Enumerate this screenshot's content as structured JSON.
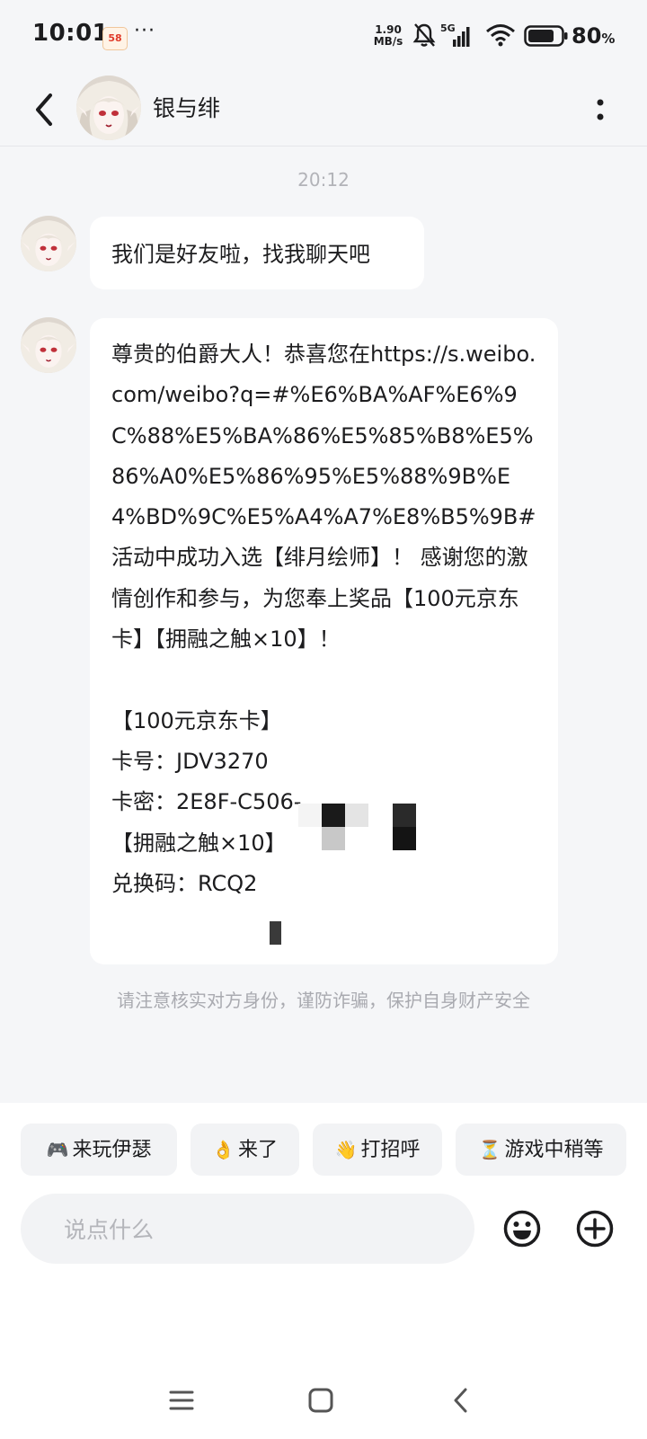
{
  "status_bar": {
    "time": "10:01",
    "app_badge": "58",
    "more": "···",
    "net_speed_value": "1.90",
    "net_speed_unit": "MB/s",
    "network": "5G",
    "battery_value": "80",
    "battery_unit": "%"
  },
  "header": {
    "contact_name": "银与绯"
  },
  "chat": {
    "timestamp": "20:12",
    "messages": [
      {
        "text": "我们是好友啦，找我聊天吧"
      },
      {
        "text": "尊贵的伯爵大人！恭喜您在https://s.weibo.com/weibo?q=#%E6%BA%AF%E6%9C%88%E5%BA%86%E5%85%B8%E5%86%A0%E5%86%95%E5%88%9B%E4%BD%9C%E5%A4%A7%E8%B5%9B# 活动中成功入选【绯月绘师】！ 感谢您的激情创作和参与，为您奉上奖品【100元京东卡】【拥融之触×10】！\n\n【100元京东卡】\n卡号：JDV3270\n卡密：2E8F-C506-\n【拥融之触×10】\n兑换码：RCQ2"
      }
    ],
    "safety_notice": "请注意核实对方身份，谨防诈骗，保护自身财产安全"
  },
  "quick_replies": [
    {
      "icon": "🎮",
      "label": "来玩伊瑟"
    },
    {
      "icon": "👌",
      "label": "来了"
    },
    {
      "icon": "👋",
      "label": "打招呼"
    },
    {
      "icon": "⏳",
      "label": "游戏中稍等"
    }
  ],
  "composer": {
    "placeholder": "说点什么"
  }
}
